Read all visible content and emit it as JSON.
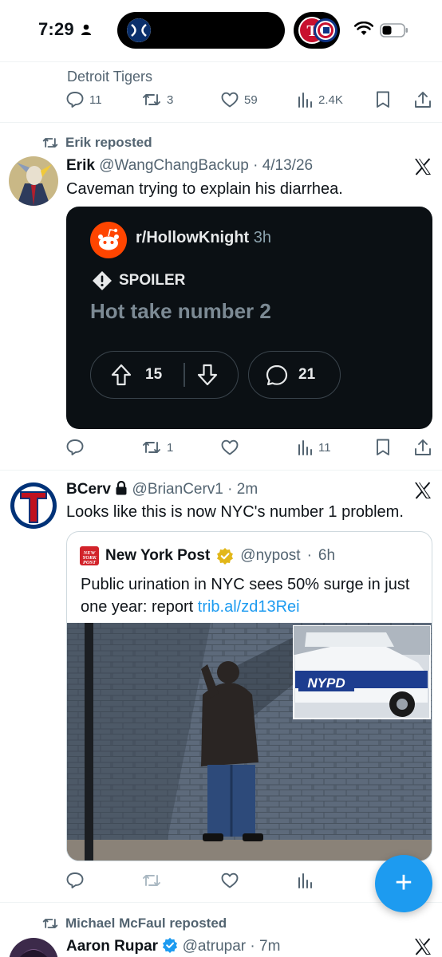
{
  "status_bar": {
    "time": "7:29"
  },
  "previous_tweet": {
    "name_line": "Detroit Tigers",
    "replies": "11",
    "reposts": "3",
    "likes": "59",
    "views": "2.4K"
  },
  "tweets": [
    {
      "repost_label": "Erik reposted",
      "name": "Erik",
      "handle": "@WangChangBackup",
      "time": "4/13/26",
      "text": "Caveman trying to explain his diarrhea.",
      "reddit": {
        "subreddit": "r/HollowKnight",
        "age": "3h",
        "spoiler": "SPOILER",
        "title": "Hot take number 2",
        "upvotes": "15",
        "comments": "21"
      },
      "replies": "",
      "reposts": "1",
      "likes": "",
      "views": "11"
    },
    {
      "name": "BCerv",
      "handle": "@BrianCerv1",
      "time": "2m",
      "text": "Looks like this is now NYC's number 1 problem.",
      "quote": {
        "name": "New York Post",
        "handle": "@nypost",
        "time": "6h",
        "text": "Public urination in NYC sees 50% surge in just one year: report",
        "link": "trib.al/zd13Rei",
        "inset_label": "NYPD",
        "logo_text": "NEW YORK POST"
      }
    },
    {
      "repost_label": "Michael McFaul reposted",
      "name": "Aaron Rupar",
      "handle": "@atrupar",
      "time": "7m"
    }
  ],
  "fab_label": "+",
  "colors": {
    "accent": "#1d9bf0",
    "muted": "#536471",
    "text": "#0f1419"
  }
}
